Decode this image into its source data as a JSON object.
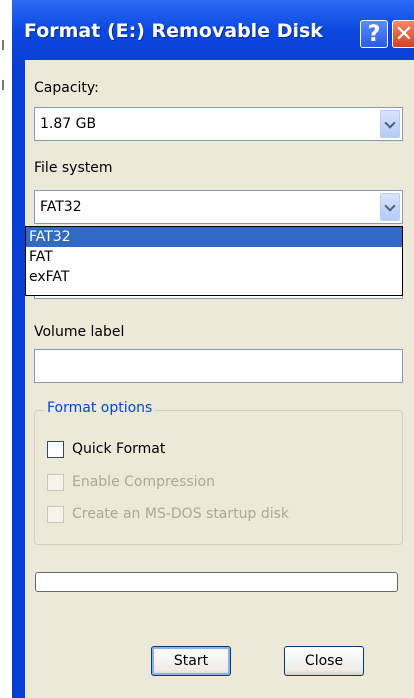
{
  "window": {
    "title": "Format (E:) Removable Disk"
  },
  "titlebar": {
    "help_glyph": "?",
    "close_glyph": "✕"
  },
  "capacity": {
    "label": "Capacity:",
    "value": "1.87 GB"
  },
  "file_system": {
    "label": "File system",
    "value": "FAT32",
    "options": [
      "FAT32",
      "FAT",
      "exFAT"
    ],
    "selected_index": 0
  },
  "volume_label": {
    "label": "Volume label",
    "value": ""
  },
  "format_options": {
    "title": "Format options",
    "quick_format": {
      "label": "Quick Format",
      "checked": false,
      "enabled": true
    },
    "enable_compression": {
      "label": "Enable Compression",
      "checked": false,
      "enabled": false
    },
    "msdos_startup": {
      "label": "Create an MS-DOS startup disk",
      "checked": false,
      "enabled": false
    }
  },
  "progress": {
    "fraction": 0
  },
  "buttons": {
    "start": "Start",
    "close": "Close"
  },
  "colors": {
    "titlebar": "#0a3ed1",
    "client": "#ece9d8",
    "selection": "#316ac5",
    "group_title": "#0046d5"
  }
}
